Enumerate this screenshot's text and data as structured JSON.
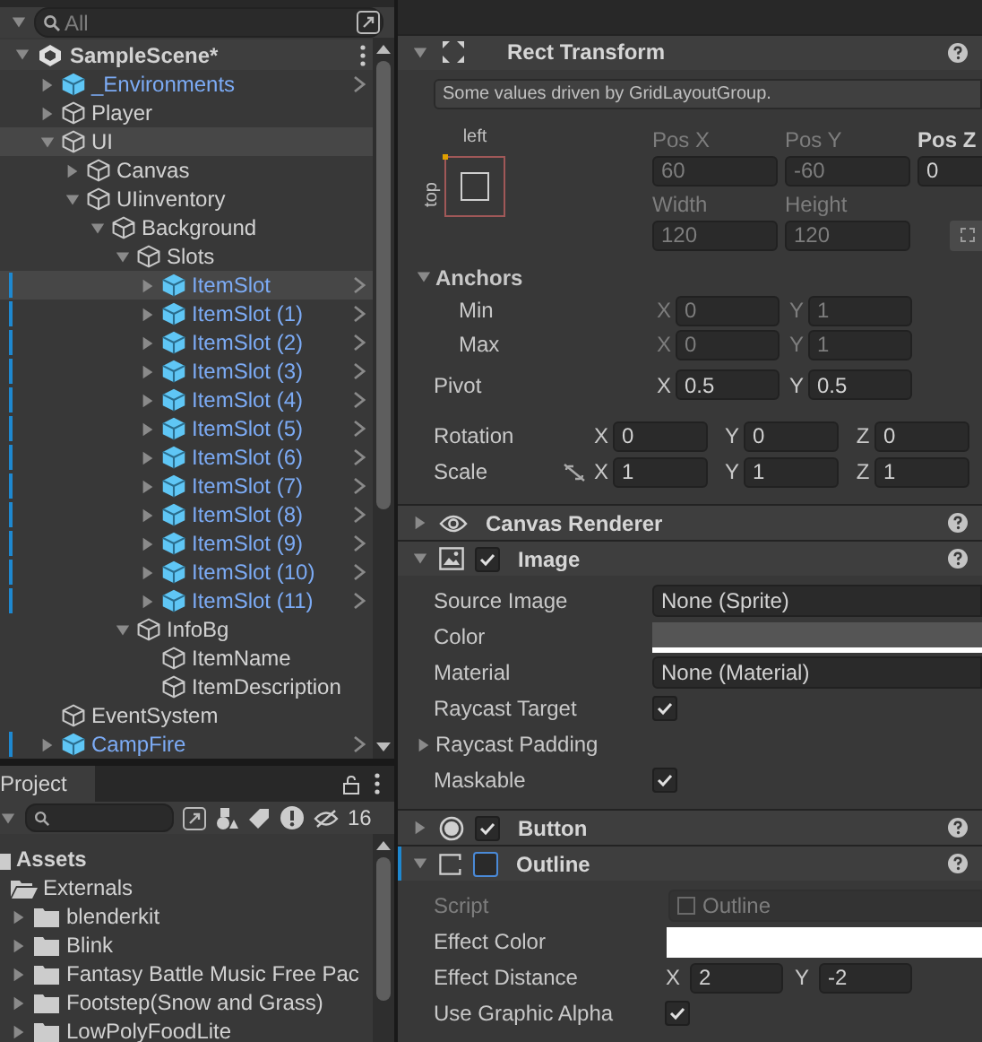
{
  "hierarchy": {
    "search": {
      "placeholder": "All"
    },
    "scene": {
      "name": "SampleScene*",
      "expanded": true
    },
    "items": [
      {
        "name": "_Environments",
        "prefab": true,
        "kind": "branch",
        "expanded": false,
        "highlighted": false,
        "overridden": false
      },
      {
        "name": "Player",
        "prefab": false,
        "kind": "branch",
        "expanded": false,
        "highlighted": false,
        "overridden": false
      },
      {
        "name": "UI",
        "prefab": false,
        "kind": "branch",
        "expanded": true,
        "highlighted": true,
        "overridden": false,
        "children": [
          {
            "name": "Canvas",
            "prefab": false,
            "kind": "branch",
            "expanded": false,
            "highlighted": false,
            "overridden": false
          },
          {
            "name": "UIinventory",
            "prefab": false,
            "kind": "branch",
            "expanded": true,
            "highlighted": false,
            "overridden": false,
            "children": [
              {
                "name": "Background",
                "prefab": false,
                "kind": "branch",
                "expanded": true,
                "highlighted": false,
                "overridden": false,
                "children": [
                  {
                    "name": "Slots",
                    "prefab": false,
                    "kind": "branch",
                    "expanded": true,
                    "highlighted": false,
                    "overridden": false,
                    "children": [
                      {
                        "name": "ItemSlot",
                        "prefab": true,
                        "kind": "branch",
                        "expanded": false,
                        "highlighted": true,
                        "overridden": true
                      },
                      {
                        "name": "ItemSlot (1)",
                        "prefab": true,
                        "kind": "branch",
                        "expanded": false,
                        "highlighted": false,
                        "overridden": true
                      },
                      {
                        "name": "ItemSlot (2)",
                        "prefab": true,
                        "kind": "branch",
                        "expanded": false,
                        "highlighted": false,
                        "overridden": true
                      },
                      {
                        "name": "ItemSlot (3)",
                        "prefab": true,
                        "kind": "branch",
                        "expanded": false,
                        "highlighted": false,
                        "overridden": true
                      },
                      {
                        "name": "ItemSlot (4)",
                        "prefab": true,
                        "kind": "branch",
                        "expanded": false,
                        "highlighted": false,
                        "overridden": true
                      },
                      {
                        "name": "ItemSlot (5)",
                        "prefab": true,
                        "kind": "branch",
                        "expanded": false,
                        "highlighted": false,
                        "overridden": true
                      },
                      {
                        "name": "ItemSlot (6)",
                        "prefab": true,
                        "kind": "branch",
                        "expanded": false,
                        "highlighted": false,
                        "overridden": true
                      },
                      {
                        "name": "ItemSlot (7)",
                        "prefab": true,
                        "kind": "branch",
                        "expanded": false,
                        "highlighted": false,
                        "overridden": true
                      },
                      {
                        "name": "ItemSlot (8)",
                        "prefab": true,
                        "kind": "branch",
                        "expanded": false,
                        "highlighted": false,
                        "overridden": true
                      },
                      {
                        "name": "ItemSlot (9)",
                        "prefab": true,
                        "kind": "branch",
                        "expanded": false,
                        "highlighted": false,
                        "overridden": true
                      },
                      {
                        "name": "ItemSlot (10)",
                        "prefab": true,
                        "kind": "branch",
                        "expanded": false,
                        "highlighted": false,
                        "overridden": true
                      },
                      {
                        "name": "ItemSlot (11)",
                        "prefab": true,
                        "kind": "branch",
                        "expanded": false,
                        "highlighted": false,
                        "overridden": true
                      }
                    ]
                  },
                  {
                    "name": "InfoBg",
                    "prefab": false,
                    "kind": "branch",
                    "expanded": true,
                    "highlighted": false,
                    "overridden": false,
                    "children": [
                      {
                        "name": "ItemName",
                        "prefab": false,
                        "kind": "leaf",
                        "highlighted": false,
                        "overridden": false
                      },
                      {
                        "name": "ItemDescription",
                        "prefab": false,
                        "kind": "leaf",
                        "highlighted": false,
                        "overridden": false
                      }
                    ]
                  }
                ]
              }
            ]
          }
        ]
      },
      {
        "name": "EventSystem",
        "prefab": false,
        "kind": "leaf",
        "highlighted": false,
        "overridden": false
      },
      {
        "name": "CampFire",
        "prefab": true,
        "kind": "branch",
        "expanded": false,
        "highlighted": false,
        "overridden": true
      }
    ]
  },
  "project": {
    "tab": "Project",
    "hidden_count": "16",
    "root": {
      "name": "Assets"
    },
    "open_folder": {
      "name": "Externals"
    },
    "folders": [
      {
        "name": "blenderkit"
      },
      {
        "name": "Blink"
      },
      {
        "name": "Fantasy Battle Music Free Pac"
      },
      {
        "name": "Footstep(Snow and Grass)"
      },
      {
        "name": "LowPolyFoodLite"
      }
    ]
  },
  "inspector": {
    "rect_transform": {
      "title": "Rect Transform",
      "note": "Some values driven by GridLayoutGroup.",
      "anchor_h": "left",
      "anchor_v": "top",
      "pos": [
        {
          "label": "Pos X",
          "value": "60",
          "driven": true
        },
        {
          "label": "Pos Y",
          "value": "-60",
          "driven": true
        },
        {
          "label": "Pos Z",
          "value": "0",
          "driven": false
        }
      ],
      "size": [
        {
          "label": "Width",
          "value": "120",
          "driven": true
        },
        {
          "label": "Height",
          "value": "120",
          "driven": true
        }
      ],
      "anchors": {
        "label": "Anchors",
        "expanded": true,
        "rows": [
          {
            "label": "Min",
            "values": [
              {
                "axis": "X",
                "value": "0"
              },
              {
                "axis": "Y",
                "value": "1"
              }
            ]
          },
          {
            "label": "Max",
            "values": [
              {
                "axis": "X",
                "value": "0"
              },
              {
                "axis": "Y",
                "value": "1"
              }
            ]
          }
        ]
      },
      "pivot": {
        "label": "Pivot",
        "values": [
          {
            "axis": "X",
            "value": "0.5"
          },
          {
            "axis": "Y",
            "value": "0.5"
          }
        ]
      },
      "rotation": {
        "label": "Rotation",
        "values": [
          {
            "axis": "X",
            "value": "0"
          },
          {
            "axis": "Y",
            "value": "0"
          },
          {
            "axis": "Z",
            "value": "0"
          }
        ]
      },
      "scale": {
        "label": "Scale",
        "values": [
          {
            "axis": "X",
            "value": "1"
          },
          {
            "axis": "Y",
            "value": "1"
          },
          {
            "axis": "Z",
            "value": "1"
          }
        ]
      }
    },
    "components": [
      {
        "title": "Canvas Renderer",
        "expanded": false,
        "highlighted": false
      },
      {
        "title": "Image",
        "expanded": true,
        "highlighted": false,
        "enabled": true,
        "fields": [
          {
            "kind": "object",
            "label": "Source Image",
            "value": "None (Sprite)"
          },
          {
            "kind": "color",
            "label": "Color",
            "color": "#555555"
          },
          {
            "kind": "object",
            "label": "Material",
            "value": "None (Material)"
          },
          {
            "kind": "checkbox",
            "label": "Raycast Target",
            "checked": true
          },
          {
            "kind": "foldout",
            "label": "Raycast Padding"
          },
          {
            "kind": "checkbox",
            "label": "Maskable",
            "checked": true
          }
        ]
      },
      {
        "title": "Button",
        "expanded": false,
        "highlighted": false,
        "enabled": true
      },
      {
        "title": "Outline",
        "expanded": true,
        "highlighted": true,
        "enabled": false,
        "fields": [
          {
            "kind": "script",
            "label": "Script",
            "value": "Outline"
          },
          {
            "kind": "color",
            "label": "Effect Color",
            "color": "#ffffff"
          },
          {
            "kind": "vector2",
            "label": "Effect Distance",
            "values": [
              {
                "axis": "X",
                "value": "2"
              },
              {
                "axis": "Y",
                "value": "-2"
              }
            ]
          },
          {
            "kind": "checkbox",
            "label": "Use Graphic Alpha",
            "checked": true
          }
        ]
      }
    ]
  }
}
